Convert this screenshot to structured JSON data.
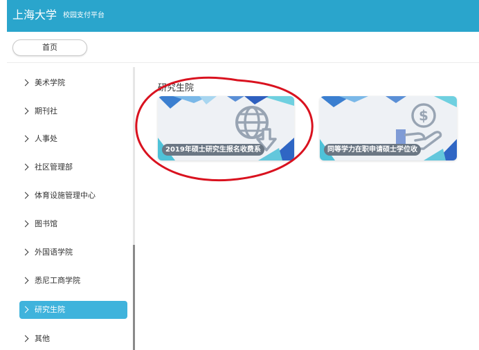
{
  "header": {
    "title": "上海大学",
    "subtitle": "校园支付平台",
    "bg_color": "#2aa5cc"
  },
  "tabs": {
    "home_label": "首页"
  },
  "sidebar": {
    "items": [
      {
        "label": "美术学院",
        "active": false
      },
      {
        "label": "期刊社",
        "active": false
      },
      {
        "label": "人事处",
        "active": false
      },
      {
        "label": "社区管理部",
        "active": false
      },
      {
        "label": "体育设施管理中心",
        "active": false
      },
      {
        "label": "图书馆",
        "active": false
      },
      {
        "label": "外国语学院",
        "active": false
      },
      {
        "label": "悉尼工商学院",
        "active": false
      },
      {
        "label": "研究生院",
        "active": true
      },
      {
        "label": "其他",
        "active": false
      }
    ],
    "active_color": "#3fb3dc"
  },
  "main": {
    "section_title": "研究生院",
    "cards": [
      {
        "label": "2019年硕士研究生报名收费系",
        "icon": "globe-download-icon"
      },
      {
        "label": "同等学力在职申请硕士学位收",
        "icon": "hand-dollar-icon"
      }
    ]
  },
  "annotation": {
    "shape": "red-ellipse",
    "color": "#d9121f"
  }
}
